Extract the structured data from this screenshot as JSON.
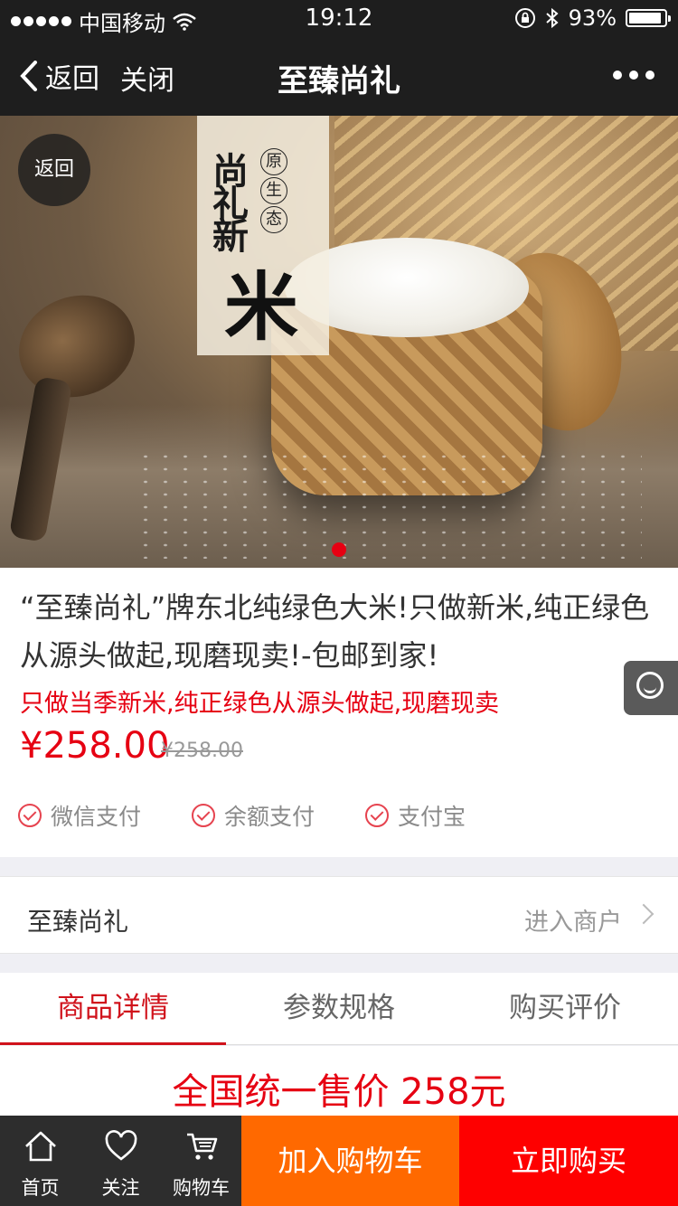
{
  "status_bar": {
    "carrier": "中国移动",
    "time": "19:12",
    "battery": "93%",
    "battery_level": 0.93,
    "icons": [
      "signal-dots-icon",
      "wifi-icon",
      "rotation-lock-icon",
      "bluetooth-icon",
      "battery-icon"
    ]
  },
  "nav": {
    "back_label": "返回",
    "close_label": "关闭",
    "title": "至臻尚礼",
    "more_icon": "more-dots-icon"
  },
  "hero": {
    "back_bubble": "返回",
    "banner_vertical": "尚礼新",
    "banner_big": "米",
    "banner_seal": [
      "原",
      "生",
      "态"
    ],
    "carousel_active_index": 0
  },
  "product": {
    "title": "“至臻尚礼”牌东北纯绿色大米!只做新米,纯正绿色从源头做起,现磨现卖!-包邮到家!",
    "subtitle": "只做当季新米,纯正绿色从源头做起,现磨现卖",
    "price": "¥258.00",
    "original_price": "¥258.00",
    "payment_methods": [
      "微信支付",
      "余额支付",
      "支付宝"
    ]
  },
  "shop": {
    "name": "至臻尚礼",
    "enter_label": "进入商户"
  },
  "tabs": {
    "items": [
      "商品详情",
      "参数规格",
      "购买评价"
    ],
    "active": 0
  },
  "detail": {
    "headline": "全国统一售价 258元"
  },
  "bottom_bar": {
    "home_label": "首页",
    "follow_label": "关注",
    "cart_label": "购物车",
    "add_to_cart_label": "加入购物车",
    "buy_now_label": "立即购买"
  },
  "colors": {
    "accent_red": "#e60012",
    "tab_active": "#d0121b",
    "cart_orange": "#ff6900",
    "buy_red": "#fe0000",
    "nav_bg": "#1e1e1e"
  }
}
